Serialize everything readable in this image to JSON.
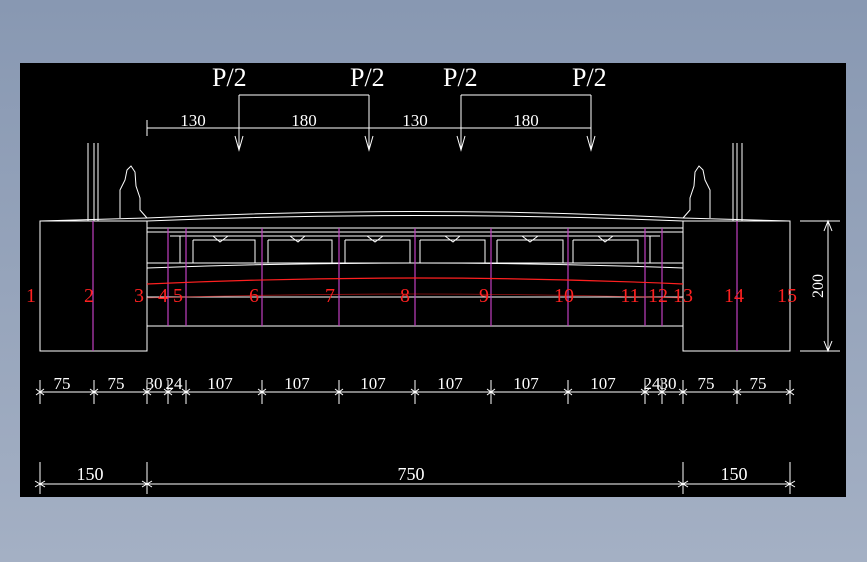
{
  "colors": {
    "background": "#000000",
    "line": "#ffffff",
    "section_line": "#c040c0",
    "section_label": "#ff2020"
  },
  "loads": [
    "P/2",
    "P/2",
    "P/2",
    "P/2"
  ],
  "load_spacings": [
    "130",
    "180",
    "130",
    "180"
  ],
  "section_labels": [
    "1",
    "2",
    "3",
    "4",
    "5",
    "6",
    "7",
    "8",
    "9",
    "10",
    "11",
    "12",
    "13",
    "14",
    "15"
  ],
  "bottom_dims": [
    "75",
    "75",
    "30",
    "24",
    "107",
    "107",
    "107",
    "107",
    "107",
    "107",
    "24",
    "30",
    "75",
    "75"
  ],
  "overall_dims": [
    "150",
    "750",
    "150"
  ],
  "height_dim": "200"
}
